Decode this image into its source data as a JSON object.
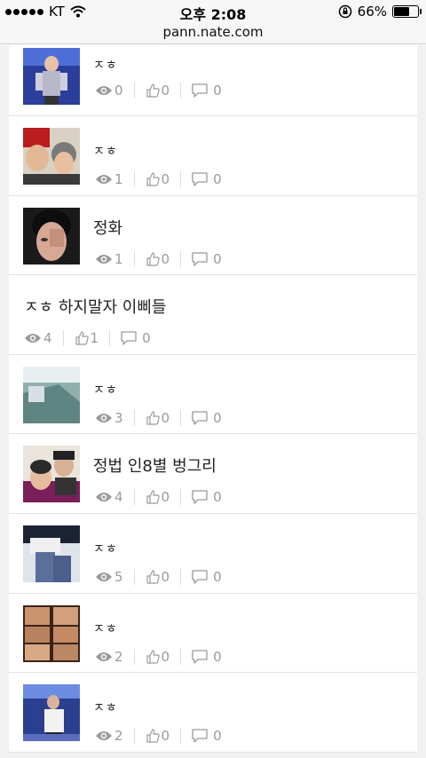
{
  "status_bar": {
    "carrier": "KT",
    "time": "오후 2:08",
    "battery": "66%",
    "battery_level": 0.66
  },
  "browser": {
    "url": "pann.nate.com"
  },
  "posts": [
    {
      "title": "ㅈㅎ",
      "views": "0",
      "likes": "0",
      "comments": "0",
      "thumb": "concert"
    },
    {
      "title": "ㅈㅎ",
      "views": "1",
      "likes": "0",
      "comments": "0",
      "thumb": "duo"
    },
    {
      "title": "정화",
      "views": "1",
      "likes": "0",
      "comments": "0",
      "thumb": "face"
    },
    {
      "title": "ㅈㅎ 하지말자 이삐들",
      "views": "4",
      "likes": "1",
      "comments": "0",
      "thumb": ""
    },
    {
      "title": "ㅈㅎ",
      "views": "3",
      "likes": "0",
      "comments": "0",
      "thumb": "teal"
    },
    {
      "title": "정법 인8별 벙그리",
      "views": "4",
      "likes": "0",
      "comments": "0",
      "thumb": "selfie"
    },
    {
      "title": "ㅈㅎ",
      "views": "5",
      "likes": "0",
      "comments": "0",
      "thumb": "jeans"
    },
    {
      "title": "ㅈㅎ",
      "views": "2",
      "likes": "0",
      "comments": "0",
      "thumb": "grid"
    },
    {
      "title": "ㅈㅎ",
      "views": "2",
      "likes": "0",
      "comments": "0",
      "thumb": "stage"
    }
  ],
  "colors": {
    "stat_text": "#9a9a9a",
    "title_text": "#222222",
    "background": "#f1f1f1"
  },
  "icons": {
    "views": "eye-icon",
    "likes": "thumbs-up-icon",
    "comments": "comment-icon"
  }
}
